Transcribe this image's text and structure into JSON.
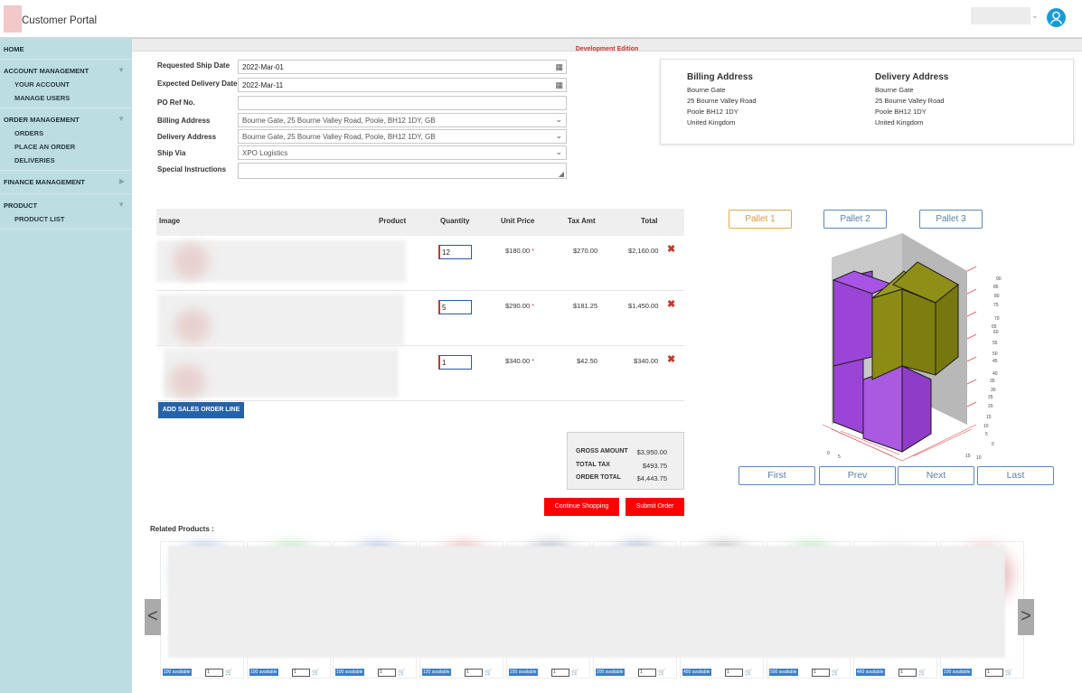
{
  "header": {
    "app_title": "Customer Portal"
  },
  "sidebar": {
    "sections": [
      {
        "label": "HOME",
        "items": []
      },
      {
        "label": "ACCOUNT MANAGEMENT",
        "items": [
          "YOUR ACCOUNT",
          "MANAGE USERS"
        ]
      },
      {
        "label": "ORDER MANAGEMENT",
        "items": [
          "ORDERS",
          "PLACE AN ORDER",
          "DELIVERIES"
        ]
      },
      {
        "label": "FINANCE MANAGEMENT",
        "items": []
      },
      {
        "label": "PRODUCT",
        "items": [
          "PRODUCT LIST"
        ]
      }
    ]
  },
  "banner": "Development Edition",
  "form": {
    "ship_date_label": "Requested Ship Date",
    "ship_date": "2022-Mar-01",
    "delivery_date_label": "Expected Delivery Date",
    "delivery_date": "2022-Mar-11",
    "po_label": "PO Ref No.",
    "po_value": "",
    "billing_label": "Billing Address",
    "billing_value": "Bourne Gate, 25 Bourne Valley Road, Poole, BH12 1DY, GB",
    "delivery_label": "Delivery Address",
    "delivery_value": "Bourne Gate, 25 Bourne Valley Road, Poole, BH12 1DY, GB",
    "shipvia_label": "Ship Via",
    "shipvia_value": "XPO Logistics",
    "instructions_label": "Special Instructions",
    "instructions_value": ""
  },
  "addresses": {
    "billing": {
      "title": "Billing Address",
      "lines": [
        "Bourne Gate",
        "25 Bourne Valley Road",
        "Poole BH12 1DY",
        "United Kingdom"
      ]
    },
    "delivery": {
      "title": "Delivery Address",
      "lines": [
        "Bourne Gate",
        "25 Bourne Valley Road",
        "Poole BH12 1DY",
        "United Kingdom"
      ]
    }
  },
  "table": {
    "headers": {
      "image": "Image",
      "product": "Product",
      "quantity": "Quantity",
      "unit_price": "Unit Price",
      "tax": "Tax Amt",
      "total": "Total"
    },
    "rows": [
      {
        "qty": "12",
        "unit_price": "$180.00",
        "tax": "$270.00",
        "total": "$2,160.00"
      },
      {
        "qty": "5",
        "unit_price": "$290.00",
        "tax": "$181.25",
        "total": "$1,450.00"
      },
      {
        "qty": "1",
        "unit_price": "$340.00",
        "tax": "$42.50",
        "total": "$340.00"
      }
    ],
    "asterisk": "*",
    "delete_glyph": "✖",
    "add_line": "ADD SALES ORDER LINE"
  },
  "totals": {
    "gross_label": "GROSS AMOUNT",
    "gross": "$3,950.00",
    "tax_label": "TOTAL TAX",
    "tax": "$493.75",
    "order_label": "ORDER TOTAL",
    "order": "$4,443.75"
  },
  "actions": {
    "continue": "Continue Shopping",
    "submit": "Submit Order"
  },
  "pallets": {
    "p1": "Pallet 1",
    "p2": "Pallet 2",
    "p3": "Pallet 3"
  },
  "pager": {
    "first": "First",
    "prev": "Prev",
    "next": "Next",
    "last": "Last"
  },
  "chart_axis": {
    "right_ticks": [
      "0",
      "5",
      "10",
      "15",
      "20",
      "25",
      "30",
      "35",
      "40",
      "45",
      "50",
      "55",
      "60",
      "65",
      "70",
      "75",
      "80",
      "85",
      "90"
    ],
    "bottom_ticks": [
      "0",
      "5",
      "10",
      "15"
    ]
  },
  "colors": {
    "purple": "#9b45d6",
    "olive": "#8c8c14",
    "accent_red": "#ff0000",
    "sidebar": "#bcdde1",
    "pallet_active": "#e0a84a",
    "pallet_inactive": "#5a8ab8"
  },
  "related": {
    "title": "Related Products :",
    "prev": "<",
    "next": ">",
    "cards": [
      {
        "avail": "100 available",
        "qty": "1",
        "blob": "#5d86c8"
      },
      {
        "avail": "100 available",
        "qty": "1",
        "blob": "#5fc266"
      },
      {
        "avail": "100 available",
        "qty": "1",
        "blob": "#3a6bb8"
      },
      {
        "avail": "120 available",
        "qty": "1",
        "blob": "#cc5050"
      },
      {
        "avail": "150 available",
        "qty": "1",
        "blob": "#3b4d66"
      },
      {
        "avail": "200 available",
        "qty": "1",
        "blob": "#3b5a8a"
      },
      {
        "avail": "450 available",
        "qty": "1",
        "blob": "#555555"
      },
      {
        "avail": "500 available",
        "qty": "1",
        "blob": "#5fc266"
      },
      {
        "avail": "460 available",
        "qty": "1",
        "blob": "#e5e5e5"
      },
      {
        "avail": "100 available",
        "qty": "1",
        "blob": "#e0a0a0"
      }
    ]
  }
}
